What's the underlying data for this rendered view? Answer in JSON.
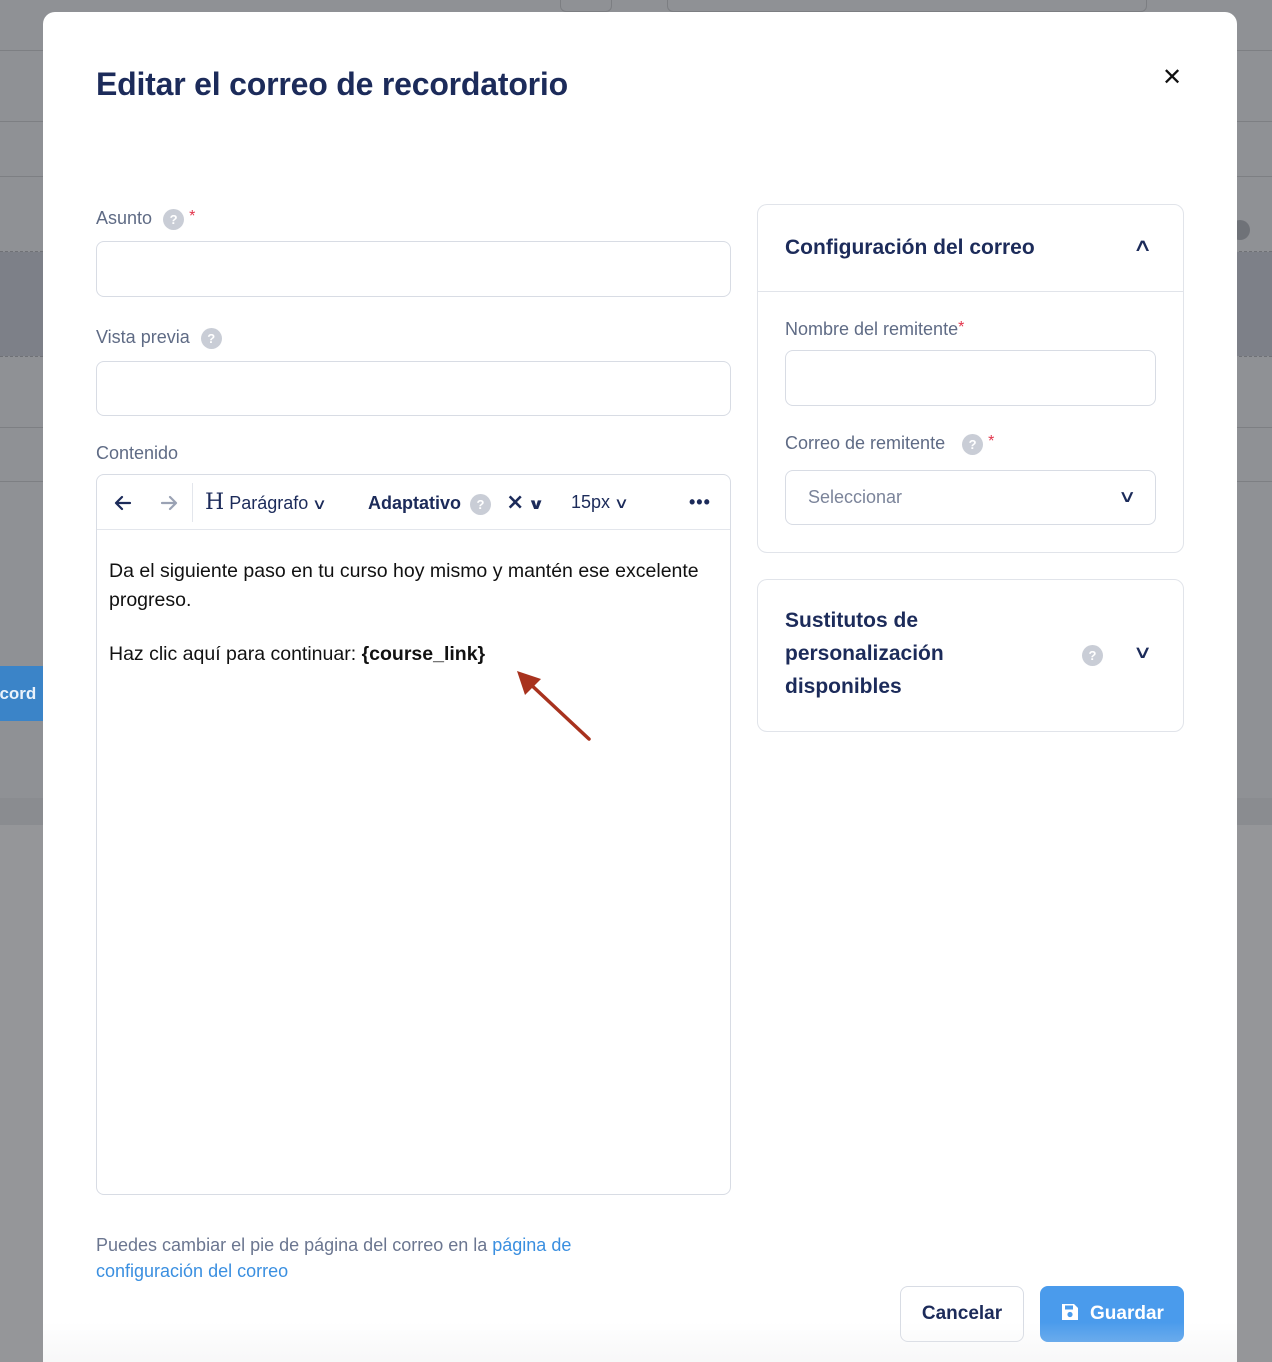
{
  "background": {
    "button_fragment": "ecord"
  },
  "modal": {
    "title": "Editar el correo de recordatorio",
    "close_icon": "close-icon"
  },
  "form": {
    "subject": {
      "label": "Asunto",
      "required_mark": "*",
      "value": "",
      "placeholder": ""
    },
    "preview": {
      "label": "Vista previa",
      "value": "",
      "placeholder": ""
    },
    "content": {
      "label": "Contenido"
    }
  },
  "toolbar": {
    "undo_icon": "arrow-left-icon",
    "redo_icon": "arrow-right-icon",
    "heading_icon": "H",
    "block_type": "Parágrafo",
    "font": "Adaptativo",
    "clear_icon": "×",
    "font_size": "15px",
    "more_icon": "•••"
  },
  "editor": {
    "paragraph_1": "Da el siguiente paso en tu curso hoy mismo y mantén ese excelente progreso.",
    "paragraph_2_prefix": "Haz clic aquí para continuar: ",
    "paragraph_2_placeholder": "{course_link}",
    "annotation_color": "#a8321e"
  },
  "footer": {
    "note_prefix": "Puedes cambiar el pie de página del correo en la ",
    "note_link": "página de configuración del correo"
  },
  "email_config": {
    "title": "Configuración del correo",
    "sender_name": {
      "label": "Nombre del remitente",
      "required_mark": "*",
      "value": ""
    },
    "sender_email": {
      "label": "Correo de remitente",
      "required_mark": "*",
      "selected": "Seleccionar"
    }
  },
  "substitutes": {
    "title": "Sustitutos de personalización disponibles"
  },
  "actions": {
    "cancel": "Cancelar",
    "save": "Guardar"
  },
  "colors": {
    "primary": "#4a9bec",
    "title_text": "#1c2b5a",
    "link": "#3a8fe0",
    "required": "#e2344b"
  }
}
